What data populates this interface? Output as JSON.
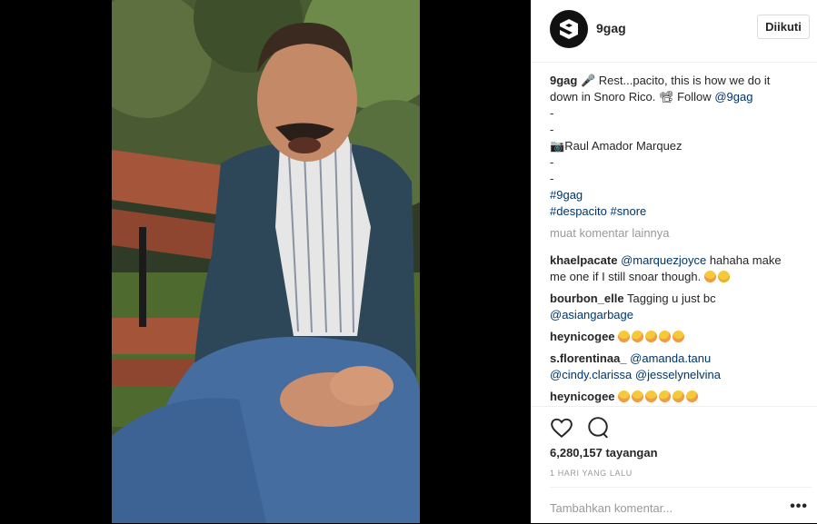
{
  "post": {
    "username": "9gag",
    "follow_label": "Diikuti",
    "caption_lines": [
      "Rest...pacito, this is how we do it",
      "down in Snoro Rico.",
      "Follow",
      "@9gag",
      "-",
      "-",
      "Raul Amador Marquez",
      "-",
      "-",
      "#9gag",
      "#despacito",
      "#snore"
    ],
    "load_more": "muat komentar lainnya",
    "comments": [
      {
        "user": "khaelpacate",
        "mention": "@marquezjoyce",
        "text": "hahaha make",
        "text2": "me one if I still snoar though."
      },
      {
        "user": "bourbon_elle",
        "text": "Tagging u just bc",
        "mention": "@asiangarbage"
      },
      {
        "user": "heynicogee"
      },
      {
        "user": "s.florentinaa_",
        "mention": "@amanda.tanu",
        "mention2": "@cindy.clarissa",
        "mention3": "@jesselynelvina"
      },
      {
        "user": "heynicogee"
      }
    ],
    "views": "6,280,157 tayangan",
    "time": "1 HARI YANG LALU",
    "comment_placeholder": "Tambahkan komentar...",
    "more_label": "•••"
  },
  "icons": {
    "avatar": "9gag-logo-icon",
    "like": "heart-icon",
    "comment": "speech-bubble-icon",
    "caption_emoji_1": "microphone-icon",
    "caption_emoji_2": "camera-icon",
    "caption_emoji_3": "video-camera-icon",
    "comment_emojis": "laughing-emoji-icon"
  },
  "colors": {
    "link": "#003569",
    "muted": "#999999",
    "text": "#262626",
    "border": "#dbdbdb"
  }
}
